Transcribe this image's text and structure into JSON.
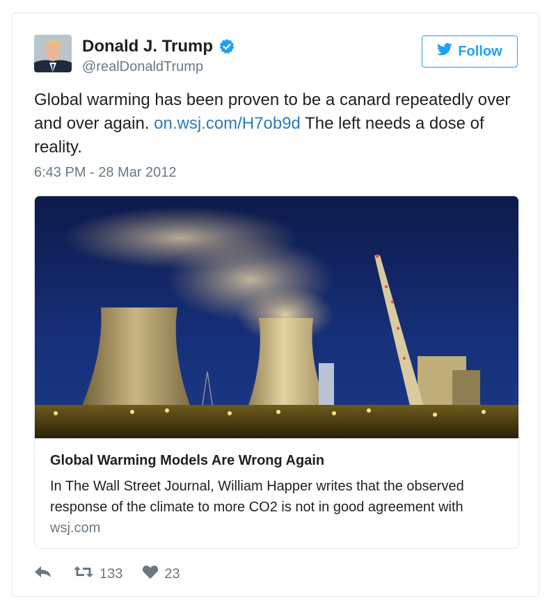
{
  "author": {
    "name": "Donald J. Trump",
    "handle": "@realDonaldTrump",
    "verified": true
  },
  "follow_button": {
    "label": "Follow"
  },
  "tweet": {
    "text_before_link": "Global warming has been proven to be a canard repeatedly over and over again. ",
    "link_text": "on.wsj.com/H7ob9d",
    "text_after_link": " The left needs a dose of reality.",
    "timestamp": "6:43 PM - 28 Mar 2012"
  },
  "card": {
    "title": "Global Warming Models Are Wrong Again",
    "description": "In The Wall Street Journal, William Happer writes that the observed response of the climate to more CO2 is not in good agreement with",
    "domain": "wsj.com"
  },
  "actions": {
    "retweet_count": "133",
    "like_count": "23"
  },
  "colors": {
    "accent": "#1da1f2",
    "link": "#2b7bb9",
    "muted": "#697882",
    "border": "#e1e8ed"
  }
}
